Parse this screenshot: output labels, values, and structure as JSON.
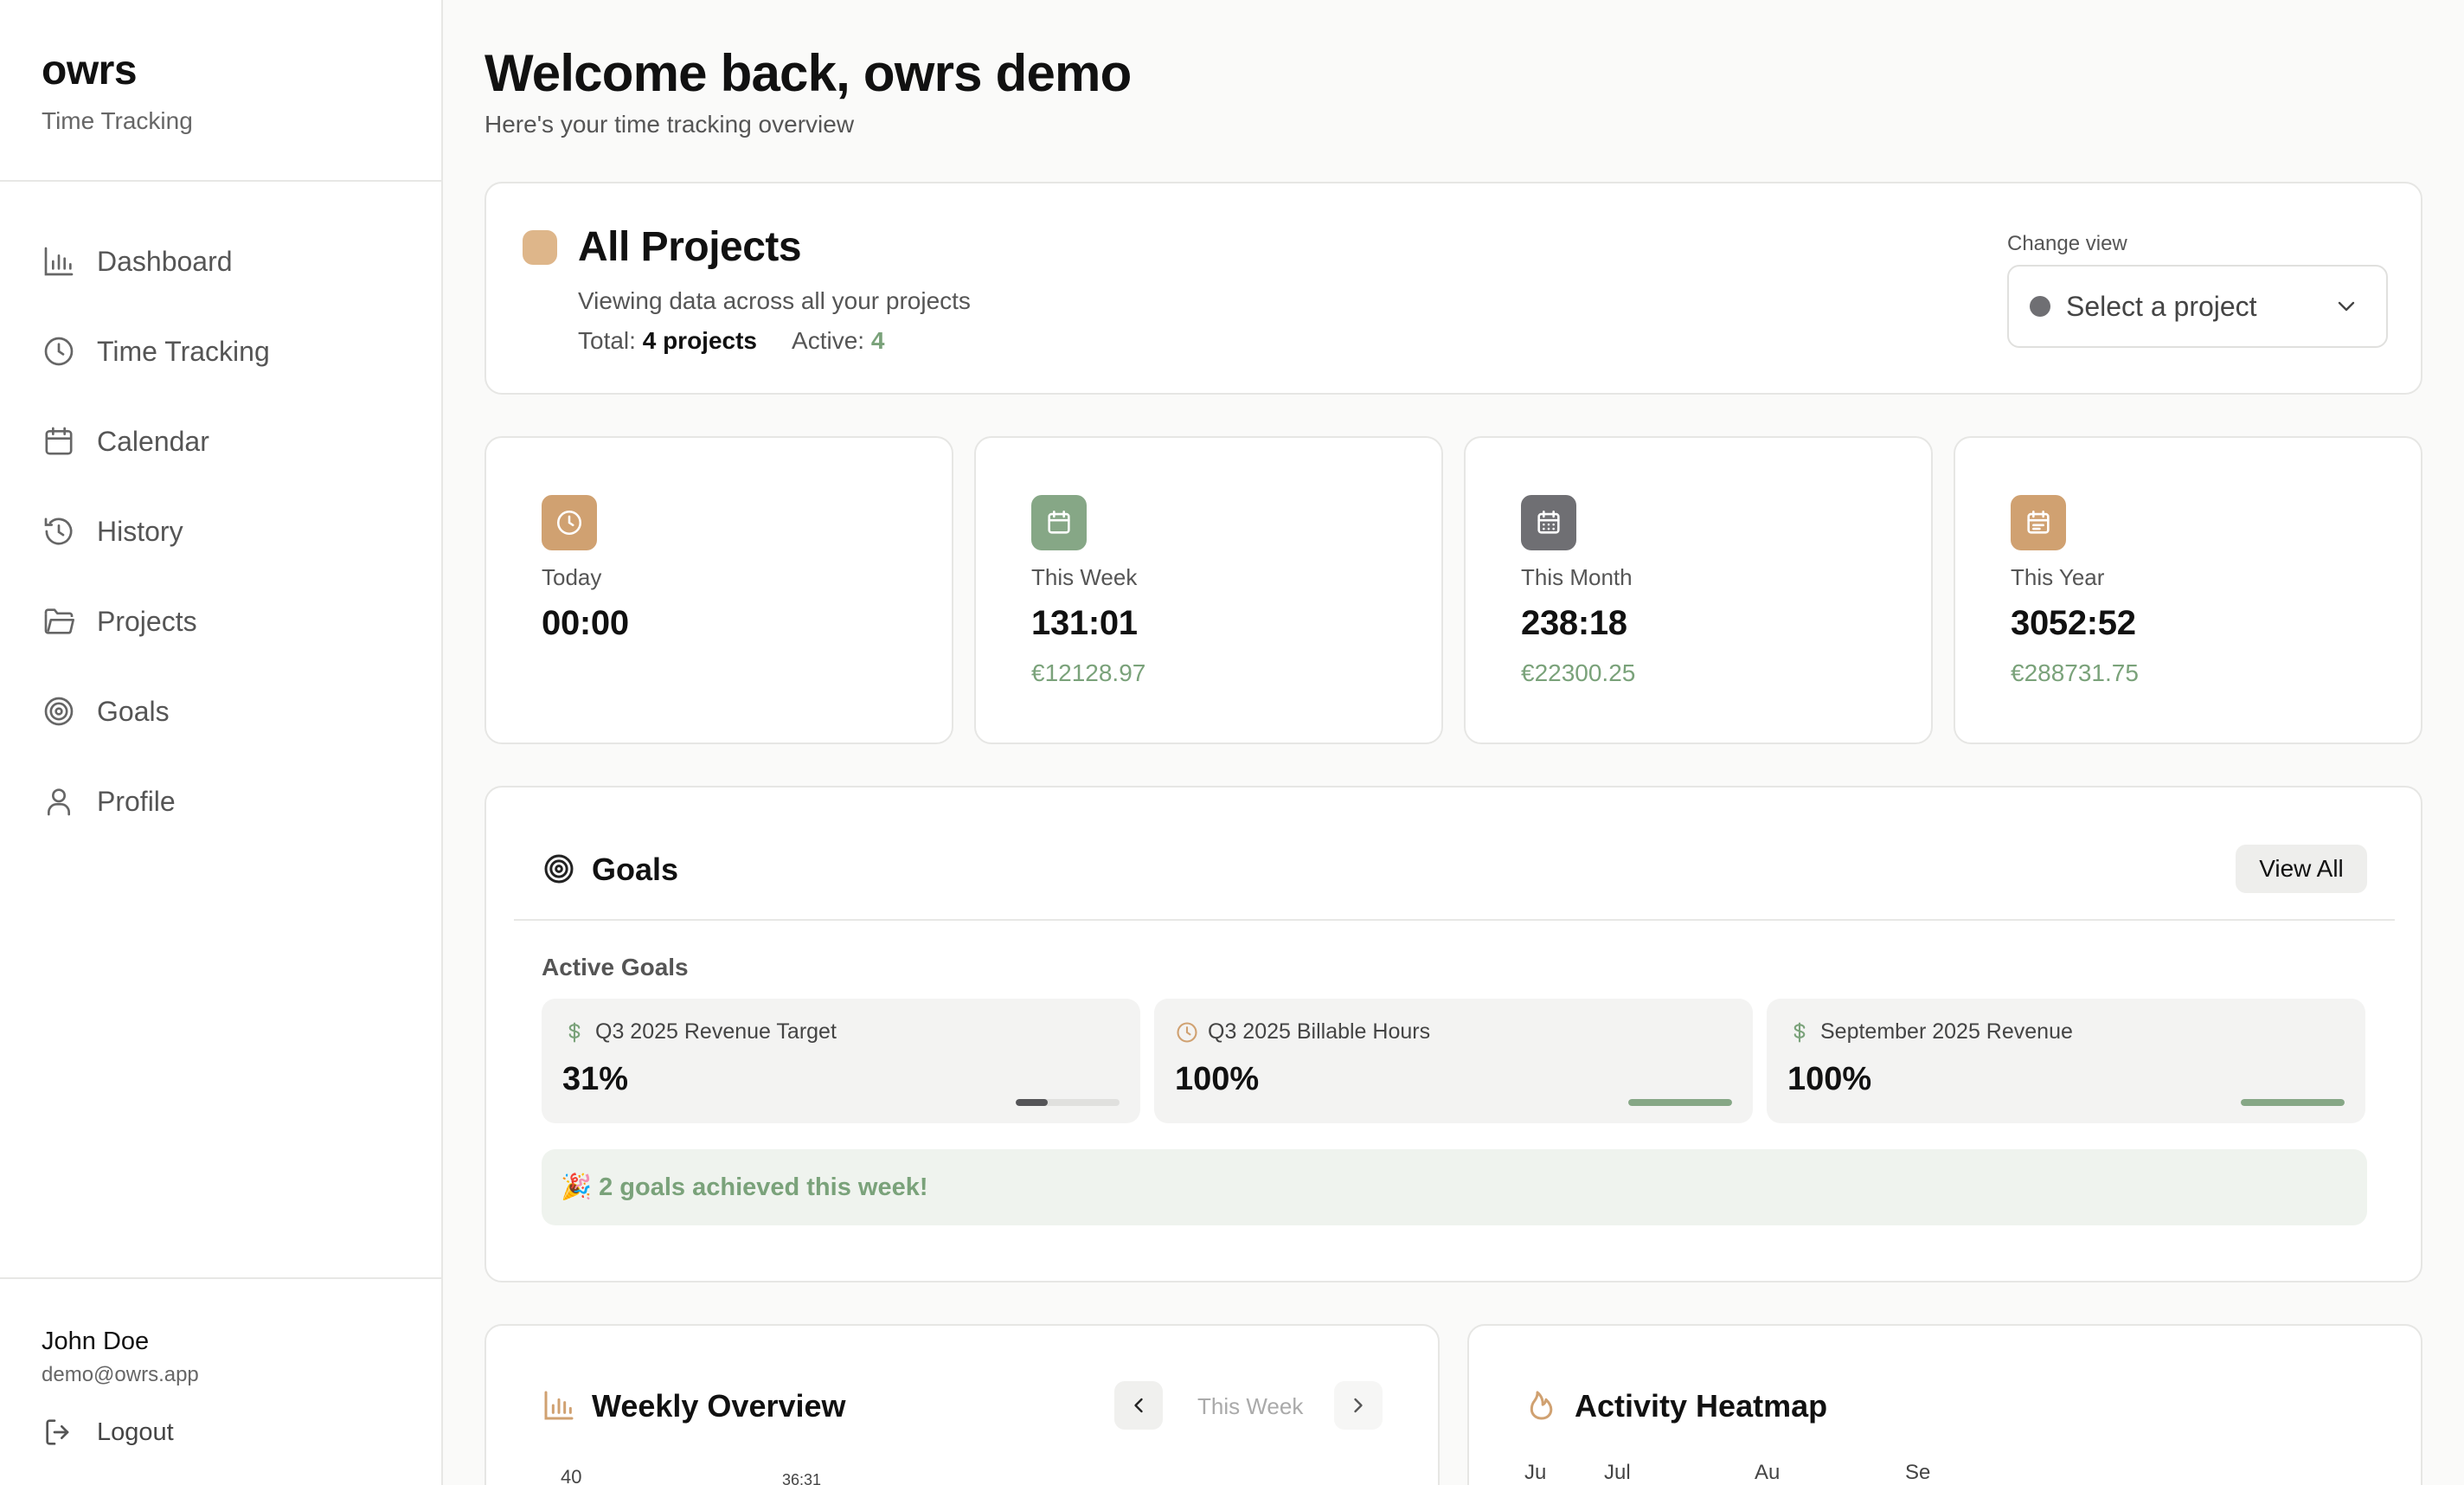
{
  "brand": {
    "name": "owrs",
    "subtitle": "Time Tracking"
  },
  "nav": [
    {
      "label": "Dashboard",
      "icon": "bar-chart-icon"
    },
    {
      "label": "Time Tracking",
      "icon": "clock-icon"
    },
    {
      "label": "Calendar",
      "icon": "calendar-icon"
    },
    {
      "label": "History",
      "icon": "history-icon"
    },
    {
      "label": "Projects",
      "icon": "folder-icon"
    },
    {
      "label": "Goals",
      "icon": "target-icon"
    },
    {
      "label": "Profile",
      "icon": "user-icon"
    }
  ],
  "user": {
    "name": "John Doe",
    "email": "demo@owrs.app",
    "logout_label": "Logout"
  },
  "header": {
    "title": "Welcome back, owrs demo",
    "subtitle": "Here's your time tracking overview"
  },
  "projects": {
    "title": "All Projects",
    "subtitle": "Viewing data across all your projects",
    "total_label": "Total:",
    "total_value": "4 projects",
    "active_label": "Active:",
    "active_value": "4",
    "change_view_label": "Change view",
    "select_placeholder": "Select a project",
    "accent_color": "#deb68a"
  },
  "stats": [
    {
      "label": "Today",
      "value": "00:00",
      "money": "",
      "icon": "clock-icon",
      "color": "#d0a171"
    },
    {
      "label": "This Week",
      "value": "131:01",
      "money": "€12128.97",
      "icon": "calendar-icon",
      "color": "#86a786"
    },
    {
      "label": "This Month",
      "value": "238:18",
      "money": "€22300.25",
      "icon": "calendar-grid-icon",
      "color": "#6f6f73"
    },
    {
      "label": "This Year",
      "value": "3052:52",
      "money": "€288731.75",
      "icon": "calendar-list-icon",
      "color": "#d0a171"
    }
  ],
  "goals": {
    "title": "Goals",
    "view_all_label": "View All",
    "active_label": "Active Goals",
    "items": [
      {
        "name": "Q3 2025 Revenue Target",
        "percent_text": "31%",
        "progress": 0.31,
        "icon": "dollar-icon",
        "bar_color": "#555558"
      },
      {
        "name": "Q3 2025 Billable Hours",
        "percent_text": "100%",
        "progress": 1.0,
        "icon": "clock-icon",
        "bar_color": "#86a786"
      },
      {
        "name": "September 2025 Revenue",
        "percent_text": "100%",
        "progress": 1.0,
        "icon": "dollar-icon",
        "bar_color": "#86a786"
      }
    ],
    "achieved_emoji": "🎉",
    "achieved_text": "2 goals achieved this week!"
  },
  "weekly": {
    "title": "Weekly Overview",
    "week_label": "This Week",
    "y_tick_top": "40",
    "bar_value_label": "36:31"
  },
  "heatmap": {
    "title": "Activity Heatmap",
    "months": [
      "Ju",
      "Jul",
      "Au",
      "Se"
    ]
  }
}
